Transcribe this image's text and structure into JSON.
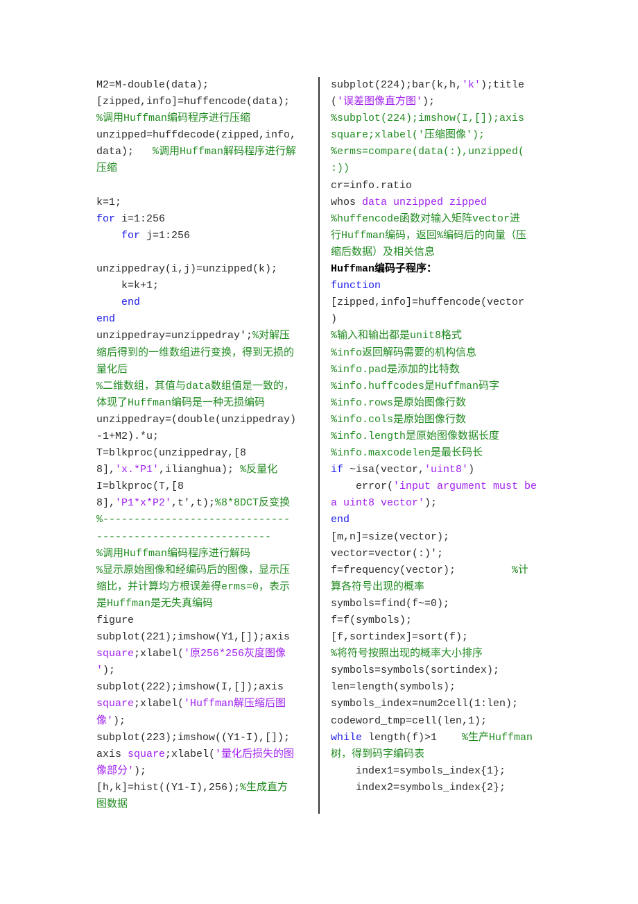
{
  "colors": {
    "code": "#2b2b2b",
    "keyword": "#1a1ae6",
    "string": "#a020f0",
    "comment": "#228b22",
    "heading": "#000000",
    "divider": "#333333"
  },
  "left_column": {
    "lines": [
      [
        {
          "t": "code",
          "s": "M2=M-double(data);"
        }
      ],
      [
        {
          "t": "code",
          "s": "[zipped,info]=huffencode(data);"
        }
      ],
      [
        {
          "t": "cmt",
          "s": "%调用Huffman编码程序进行压缩"
        }
      ],
      [
        {
          "t": "code",
          "s": "unzipped=huffdecode(zipped,info,"
        }
      ],
      [
        {
          "t": "code",
          "s": "data);   "
        },
        {
          "t": "cmt",
          "s": "%调用Huffman解码程序进行解"
        }
      ],
      [
        {
          "t": "cmt",
          "s": "压缩"
        }
      ],
      [],
      [
        {
          "t": "code",
          "s": "k=1;"
        }
      ],
      [
        {
          "t": "kw",
          "s": "for"
        },
        {
          "t": "code",
          "s": " i=1:256"
        }
      ],
      [
        {
          "t": "code",
          "s": "    "
        },
        {
          "t": "kw",
          "s": "for"
        },
        {
          "t": "code",
          "s": " j=1:256"
        }
      ],
      [],
      [
        {
          "t": "code",
          "s": "unzippedray(i,j)=unzipped(k);"
        }
      ],
      [
        {
          "t": "code",
          "s": "    k=k+1;"
        }
      ],
      [
        {
          "t": "code",
          "s": "    "
        },
        {
          "t": "kw",
          "s": "end"
        }
      ],
      [
        {
          "t": "kw",
          "s": "end"
        }
      ],
      [
        {
          "t": "code",
          "s": "unzippedray=unzippedray';"
        },
        {
          "t": "cmt",
          "s": "%对解压"
        }
      ],
      [
        {
          "t": "cmt",
          "s": "缩后得到的一维数组进行变换，得到无损的"
        }
      ],
      [
        {
          "t": "cmt",
          "s": "量化后"
        }
      ],
      [
        {
          "t": "cmt",
          "s": "%二维数组，其值与data数组值是一致的，"
        }
      ],
      [
        {
          "t": "cmt",
          "s": "体现了Huffman编码是一种无损编码"
        }
      ],
      [
        {
          "t": "code",
          "s": "unzippedray=(double(unzippedray)"
        }
      ],
      [
        {
          "t": "code",
          "s": "-1+M2).*u;"
        }
      ],
      [
        {
          "t": "code",
          "s": "T=blkproc(unzippedray,[8"
        }
      ],
      [
        {
          "t": "code",
          "s": "8],"
        },
        {
          "t": "str",
          "s": "'x.*P1'"
        },
        {
          "t": "code",
          "s": ",ilianghua); "
        },
        {
          "t": "cmt",
          "s": "%反量化"
        }
      ],
      [
        {
          "t": "code",
          "s": "I=blkproc(T,[8"
        }
      ],
      [
        {
          "t": "code",
          "s": "8],"
        },
        {
          "t": "str",
          "s": "'P1*x*P2'"
        },
        {
          "t": "code",
          "s": ",t',t);"
        },
        {
          "t": "cmt",
          "s": "%8*8DCT反变换"
        }
      ],
      [
        {
          "t": "cmt",
          "s": "%------------------------------"
        }
      ],
      [
        {
          "t": "cmt",
          "s": "----------------------------"
        }
      ],
      [
        {
          "t": "cmt",
          "s": "%调用Huffman编码程序进行解码"
        }
      ],
      [
        {
          "t": "cmt",
          "s": "%显示原始图像和经编码后的图像，显示压"
        }
      ],
      [
        {
          "t": "cmt",
          "s": "缩比，并计算均方根误差得erms=0，表示"
        }
      ],
      [
        {
          "t": "cmt",
          "s": "是Huffman是无失真编码"
        }
      ],
      [
        {
          "t": "code",
          "s": "figure"
        }
      ],
      [
        {
          "t": "code",
          "s": "subplot(221);imshow(Y1,[]);axis"
        }
      ],
      [
        {
          "t": "str",
          "s": "square"
        },
        {
          "t": "code",
          "s": ";xlabel("
        },
        {
          "t": "str",
          "s": "'原256*256灰度图像"
        }
      ],
      [
        {
          "t": "str",
          "s": "'"
        },
        {
          "t": "code",
          "s": ");"
        }
      ],
      [
        {
          "t": "code",
          "s": "subplot(222);imshow(I,[]);axis"
        }
      ],
      [
        {
          "t": "str",
          "s": "square"
        },
        {
          "t": "code",
          "s": ";xlabel("
        },
        {
          "t": "str",
          "s": "'Huffman解压缩后图"
        }
      ],
      [
        {
          "t": "str",
          "s": "像'"
        },
        {
          "t": "code",
          "s": ");"
        }
      ],
      [
        {
          "t": "code",
          "s": "subplot(223);imshow((Y1-I),[]);"
        }
      ],
      [
        {
          "t": "code",
          "s": "axis "
        },
        {
          "t": "str",
          "s": "square"
        },
        {
          "t": "code",
          "s": ";xlabel("
        },
        {
          "t": "str",
          "s": "'量化后损失的图"
        }
      ],
      [
        {
          "t": "str",
          "s": "像部分'"
        },
        {
          "t": "code",
          "s": ");"
        }
      ],
      [
        {
          "t": "code",
          "s": "[h,k]=hist((Y1-I),256);"
        },
        {
          "t": "cmt",
          "s": "%生成直方"
        }
      ],
      [
        {
          "t": "cmt",
          "s": "图数据"
        }
      ]
    ]
  },
  "right_column": {
    "lines": [
      [
        {
          "t": "code",
          "s": "subplot(224);bar(k,h,"
        },
        {
          "t": "str",
          "s": "'k'"
        },
        {
          "t": "code",
          "s": ");title"
        }
      ],
      [
        {
          "t": "code",
          "s": "("
        },
        {
          "t": "str",
          "s": "'误差图像直方图'"
        },
        {
          "t": "code",
          "s": ");"
        }
      ],
      [
        {
          "t": "cmt",
          "s": "%subplot(224);imshow(I,[]);axis"
        }
      ],
      [
        {
          "t": "cmt",
          "s": "square;xlabel('压缩图像');"
        }
      ],
      [
        {
          "t": "cmt",
          "s": "%erms=compare(data(:),unzipped("
        }
      ],
      [
        {
          "t": "cmt",
          "s": ":))"
        }
      ],
      [
        {
          "t": "code",
          "s": "cr=info.ratio"
        }
      ],
      [
        {
          "t": "code",
          "s": "whos "
        },
        {
          "t": "str",
          "s": "data unzipped zipped"
        }
      ],
      [
        {
          "t": "cmt",
          "s": "%huffencode函数对输入矩阵vector进"
        }
      ],
      [
        {
          "t": "cmt",
          "s": "行Huffman编码，返回%编码后的向量（压"
        }
      ],
      [
        {
          "t": "cmt",
          "s": "缩后数据）及相关信息"
        }
      ],
      [
        {
          "t": "bold",
          "s": "Huffman编码子程序："
        }
      ],
      [
        {
          "t": "kw",
          "s": "function"
        }
      ],
      [
        {
          "t": "code",
          "s": "[zipped,info]=huffencode(vector"
        }
      ],
      [
        {
          "t": "code",
          "s": ")"
        }
      ],
      [
        {
          "t": "cmt",
          "s": "%输入和输出都是unit8格式"
        }
      ],
      [
        {
          "t": "cmt",
          "s": "%info返回解码需要的机构信息"
        }
      ],
      [
        {
          "t": "cmt",
          "s": "%info.pad是添加的比特数"
        }
      ],
      [
        {
          "t": "cmt",
          "s": "%info.huffcodes是Huffman码字"
        }
      ],
      [
        {
          "t": "cmt",
          "s": "%info.rows是原始图像行数"
        }
      ],
      [
        {
          "t": "cmt",
          "s": "%info.cols是原始图像行数"
        }
      ],
      [
        {
          "t": "cmt",
          "s": "%info.length是原始图像数据长度"
        }
      ],
      [
        {
          "t": "cmt",
          "s": "%info.maxcodelen是最长码长"
        }
      ],
      [
        {
          "t": "kw",
          "s": "if"
        },
        {
          "t": "code",
          "s": " ~isa(vector,"
        },
        {
          "t": "str",
          "s": "'uint8'"
        },
        {
          "t": "code",
          "s": ")"
        }
      ],
      [
        {
          "t": "code",
          "s": "    error("
        },
        {
          "t": "str",
          "s": "'input argument must be"
        }
      ],
      [
        {
          "t": "str",
          "s": "a uint8 vector'"
        },
        {
          "t": "code",
          "s": ");"
        }
      ],
      [
        {
          "t": "kw",
          "s": "end"
        }
      ],
      [
        {
          "t": "code",
          "s": "[m,n]=size(vector);"
        }
      ],
      [
        {
          "t": "code",
          "s": "vector=vector(:)';"
        }
      ],
      [
        {
          "t": "code",
          "s": "f=frequency(vector);         "
        },
        {
          "t": "cmt",
          "s": "%计"
        }
      ],
      [
        {
          "t": "cmt",
          "s": "算各符号出现的概率"
        }
      ],
      [
        {
          "t": "code",
          "s": "symbols=find(f~=0);"
        }
      ],
      [
        {
          "t": "code",
          "s": "f=f(symbols);"
        }
      ],
      [
        {
          "t": "code",
          "s": "[f,sortindex]=sort(f);"
        }
      ],
      [
        {
          "t": "cmt",
          "s": "%将符号按照出现的概率大小排序"
        }
      ],
      [
        {
          "t": "code",
          "s": "symbols=symbols(sortindex);"
        }
      ],
      [
        {
          "t": "code",
          "s": "len=length(symbols);"
        }
      ],
      [
        {
          "t": "code",
          "s": "symbols_index=num2cell(1:len);"
        }
      ],
      [
        {
          "t": "code",
          "s": "codeword_tmp=cell(len,1);"
        }
      ],
      [
        {
          "t": "kw",
          "s": "while"
        },
        {
          "t": "code",
          "s": " length(f)>1    "
        },
        {
          "t": "cmt",
          "s": "%生产Huffman"
        }
      ],
      [
        {
          "t": "cmt",
          "s": "树，得到码字编码表"
        }
      ],
      [
        {
          "t": "code",
          "s": "    index1=symbols_index{1};"
        }
      ],
      [
        {
          "t": "code",
          "s": "    index2=symbols_index{2};"
        }
      ]
    ]
  }
}
